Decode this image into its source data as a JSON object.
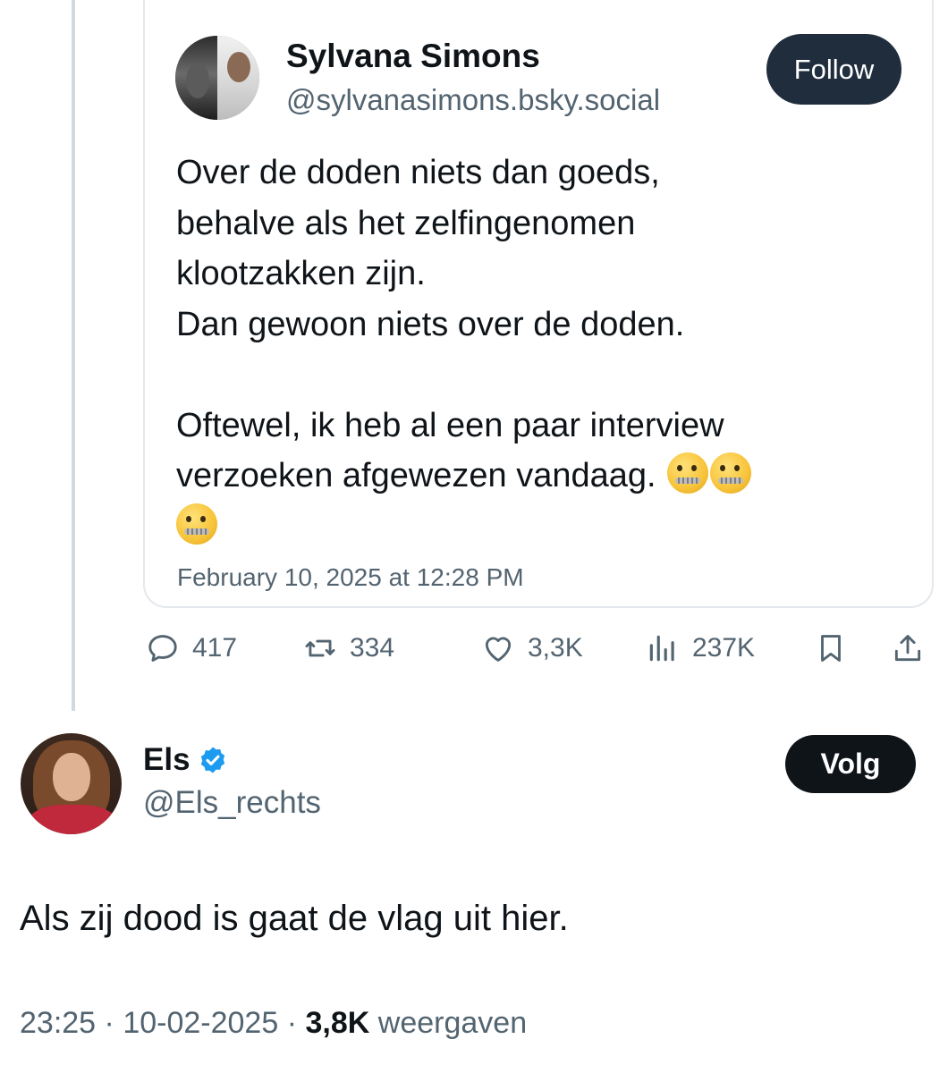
{
  "quoted_post": {
    "author_name": "Sylvana Simons",
    "author_handle": "@sylvanasimons.bsky.social",
    "follow_label": "Follow",
    "text_lines": [
      "Over de doden niets dan goeds,",
      "behalve als het zelfingenomen",
      "klootzakken zijn.",
      "Dan gewoon niets over de doden.",
      "",
      "Oftewel, ik heb al een paar interview",
      "verzoeken afgewezen vandaag."
    ],
    "text": "Over de doden niets dan goeds,\nbehalve als het zelfingenomen\nklootzakken zijn.\nDan gewoon niets over de doden.\n\nOftewel, ik heb al een paar interview\nverzoeken afgewezen vandaag.",
    "emoji": "zipper-mouth-face",
    "emoji_count": 3,
    "date": "February 10, 2025 at 12:28 PM"
  },
  "actions": {
    "replies": "417",
    "reposts": "334",
    "likes": "3,3K",
    "views": "237K"
  },
  "reply_post": {
    "author_name": "Els",
    "author_handle": "@Els_rechts",
    "verified": true,
    "follow_label": "Volg",
    "text": "Als zij dood is gaat de vlag uit hier.",
    "time": "23:25",
    "date": "10-02-2025",
    "views": "3,8K",
    "views_label": "weergaven",
    "separator": "·"
  },
  "colors": {
    "text": "#0f1419",
    "secondary": "#536471",
    "verified": "#1d9bf0",
    "follow_button": "#1f2d3d",
    "volg_button": "#0f1419",
    "border": "#e4e8ec"
  },
  "icons": [
    "reply-icon",
    "repost-icon",
    "like-icon",
    "views-icon",
    "bookmark-icon",
    "share-icon",
    "verified-badge-icon"
  ]
}
